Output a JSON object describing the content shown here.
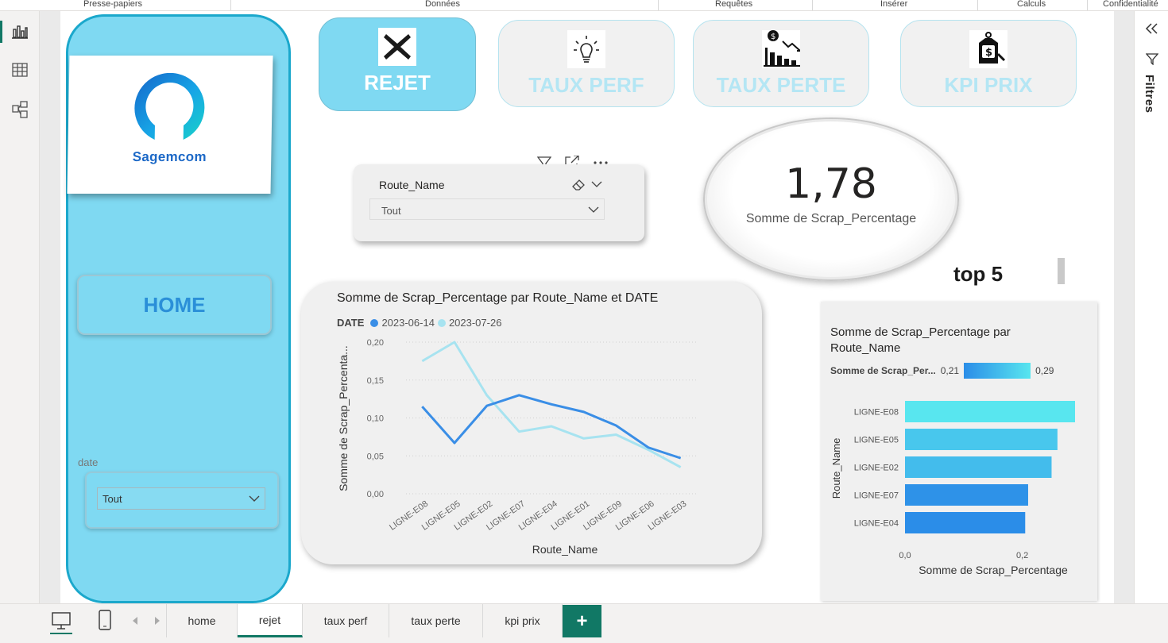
{
  "ribbon": {
    "groups": [
      "Presse-papiers",
      "Données",
      "Requêtes",
      "Insérer",
      "Calculs",
      "Confidentialité"
    ]
  },
  "left_nav": {
    "icons": [
      "report-view-icon",
      "table-view-icon",
      "model-view-icon"
    ]
  },
  "right_pane": {
    "collapse_icon": "double-chevron-left-icon",
    "filter_icon": "filter-icon",
    "label": "Filtres"
  },
  "sidebar": {
    "logo_text": "Sagemcom",
    "home_label": "HOME",
    "date_slicer": {
      "label": "date",
      "value": "Tout"
    }
  },
  "nav_buttons": [
    {
      "label": "REJET",
      "icon": "x-icon"
    },
    {
      "label": "TAUX PERF",
      "icon": "lightbulb-icon"
    },
    {
      "label": "TAUX PERTE",
      "icon": "chart-loss-icon"
    },
    {
      "label": "KPI PRIX",
      "icon": "price-tag-icon"
    }
  ],
  "route_slicer": {
    "title": "Route_Name",
    "value": "Tout"
  },
  "kpi": {
    "value": "1,78",
    "caption": "Somme de Scrap_Percentage"
  },
  "top5_label": "top 5",
  "colors": {
    "series1": "#3a8ee6",
    "series2": "#a7e3f0",
    "accent": "#117865",
    "sidebar": "#7fd9f2"
  },
  "chart_data": [
    {
      "type": "line",
      "title": "Somme de Scrap_Percentage par Route_Name et DATE",
      "legend_title": "DATE",
      "xlabel": "Route_Name",
      "ylabel": "Somme de Scrap_Percenta...",
      "categories": [
        "LIGNE-E08",
        "LIGNE-E05",
        "LIGNE-E02",
        "LIGNE-E07",
        "LIGNE-E04",
        "LIGNE-E01",
        "LIGNE-E09",
        "LIGNE-E06",
        "LIGNE-E03"
      ],
      "series": [
        {
          "name": "2023-06-14",
          "values": [
            0.115,
            0.067,
            0.116,
            0.13,
            0.118,
            0.108,
            0.09,
            0.061,
            0.047
          ]
        },
        {
          "name": "2023-07-26",
          "values": [
            0.175,
            0.2,
            0.13,
            0.082,
            0.089,
            0.073,
            0.078,
            0.058,
            0.035
          ]
        }
      ],
      "yticks": [
        "0,00",
        "0,05",
        "0,10",
        "0,15",
        "0,20"
      ],
      "ylim": [
        0,
        0.2
      ],
      "grid": true,
      "legend_position": "top-left"
    },
    {
      "type": "bar",
      "orientation": "horizontal",
      "title": "Somme de Scrap_Percentage par Route_Name",
      "legend_title": "Somme de Scrap_Per...",
      "legend_min": "0,21",
      "legend_max": "0,29",
      "categories": [
        "LIGNE-E08",
        "LIGNE-E05",
        "LIGNE-E02",
        "LIGNE-E07",
        "LIGNE-E04"
      ],
      "values": [
        0.29,
        0.26,
        0.25,
        0.21,
        0.205
      ],
      "xlabel": "Somme de Scrap_Percentage",
      "ylabel": "Route_Name",
      "xticks": [
        "0,0",
        "0,2"
      ],
      "xlim": [
        0,
        0.29
      ]
    }
  ],
  "tabs": {
    "view_icons": [
      "desktop-layout-icon",
      "mobile-layout-icon"
    ],
    "pages": [
      "home",
      "rejet",
      "taux perf",
      "taux perte",
      "kpi prix"
    ],
    "active": "rejet",
    "add_label": "+"
  }
}
